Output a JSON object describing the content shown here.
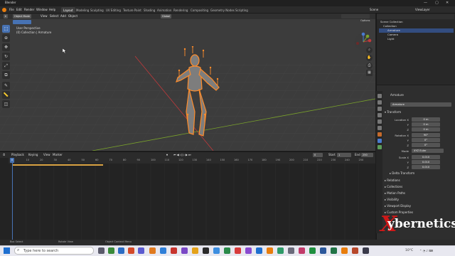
{
  "window": {
    "title": "Blender",
    "controls": [
      "—",
      "▢",
      "✕"
    ]
  },
  "menu": {
    "items": [
      "File",
      "Edit",
      "Render",
      "Window",
      "Help"
    ],
    "workspaces": [
      "Layout",
      "Modeling",
      "Sculpting",
      "UV Editing",
      "Texture Paint",
      "Shading",
      "Animation",
      "Rendering",
      "Compositing",
      "Geometry Nodes",
      "Scripting"
    ],
    "scene": "Scene",
    "view_layer": "ViewLayer"
  },
  "viewport": {
    "mode": "Object Mode",
    "menus": [
      "View",
      "Select",
      "Add",
      "Object"
    ],
    "transform": "Global",
    "info_line1": "User Perspective",
    "info_line2": "(0) Collection | Armature",
    "options": "Options"
  },
  "toolbar": {
    "tools": [
      "select-icon",
      "cursor-icon",
      "move-icon",
      "rotate-icon",
      "scale-icon",
      "transform-icon",
      "annotate-icon",
      "measure-icon",
      "add-cube-icon"
    ]
  },
  "timeline": {
    "menus": [
      "Playback",
      "Keying",
      "View",
      "Marker"
    ],
    "current_frame": "0",
    "start_label": "Start",
    "start": "1",
    "end_label": "End",
    "end": "250",
    "ticks": [
      "0",
      "10",
      "20",
      "30",
      "40",
      "50",
      "60",
      "70",
      "80",
      "90",
      "100",
      "110",
      "120",
      "130",
      "140",
      "150",
      "160",
      "170",
      "180",
      "190",
      "200",
      "210",
      "220",
      "230",
      "240",
      "250"
    ]
  },
  "status": {
    "select": "Box Select",
    "rotate": "Rotate View",
    "context": "Object Context Menu"
  },
  "outliner": {
    "rows": [
      {
        "label": "Scene Collection",
        "level": 0,
        "selected": false
      },
      {
        "label": "Collection",
        "level": 1,
        "selected": false
      },
      {
        "label": "Armature",
        "level": 2,
        "selected": true
      },
      {
        "label": "Camera",
        "level": 2,
        "selected": false
      },
      {
        "label": "Light",
        "level": 2,
        "selected": false
      }
    ]
  },
  "properties": {
    "object_name": "Armature",
    "name_field": "Armature",
    "transform_header": "Transform",
    "location": {
      "label": "Location X",
      "x": "0 m",
      "y": "0 m",
      "z": "0 m"
    },
    "rotation": {
      "label": "Rotation X",
      "x": "90°",
      "y": "0°",
      "z": "0°"
    },
    "mode_label": "Mode",
    "mode_value": "XYZ Euler",
    "scale": {
      "label": "Scale X",
      "x": "0.010",
      "y": "0.010",
      "z": "0.010"
    },
    "axis_y": "Y",
    "axis_z": "Z",
    "delta": "Delta Transform",
    "sections": [
      "Relations",
      "Collections",
      "Motion Paths",
      "Visibility",
      "Viewport Display",
      "Custom Properties"
    ]
  },
  "taskbar": {
    "search_placeholder": "Type here to search",
    "weather": "10°C",
    "time_hint": ""
  },
  "watermark": {
    "x": "X",
    "text": "ybernetics"
  },
  "colors": {
    "accent": "#4772b3",
    "axis_x": "#c0393b",
    "axis_y": "#7aa32b",
    "selected_orange": "#ff8c2a"
  }
}
